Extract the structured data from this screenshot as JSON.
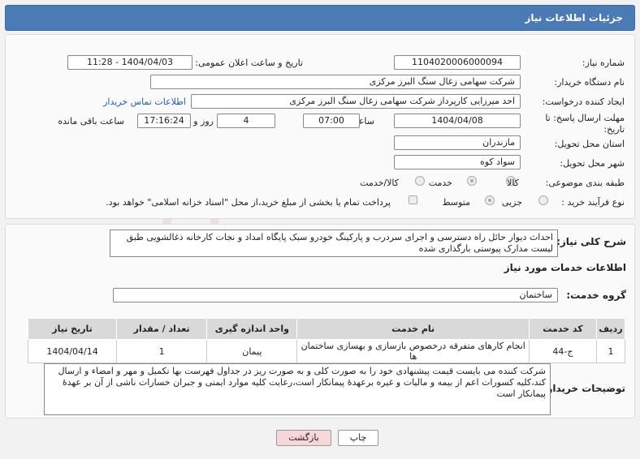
{
  "header": {
    "title": "جزئیات اطلاعات نیاز"
  },
  "fields": {
    "need_number_label": "شماره نیاز:",
    "need_number": "1104020006000094",
    "announce_label": "تاریخ و ساعت اعلان عمومی:",
    "announce_value": "1404/04/03 - 11:28",
    "buyer_org_label": "نام دستگاه خریدار:",
    "buyer_org": "شرکت سهامی زغال سنگ البرز مرکزی",
    "creator_label": "ایجاد کننده درخواست:",
    "creator": "احد میرزایی کارپرداز شرکت سهامی زغال سنگ البرز مرکزی",
    "contact_link": "اطلاعات تماس خریدار",
    "deadline_label": "مهلت ارسال پاسخ: تا تاریخ:",
    "deadline_date": "1404/04/08",
    "time_label": "ساعت",
    "deadline_time": "07:00",
    "days_value": "4",
    "days_label": "روز و",
    "remaining_time": "17:16:24",
    "remaining_label": "ساعت باقی مانده",
    "province_label": "استان محل تحویل:",
    "province": "مازندران",
    "city_label": "شهر محل تحویل:",
    "city": "سواد کوه",
    "category_label": "طبقه بندی موضوعی:",
    "category_options": [
      "کالا",
      "خدمت",
      "کالا/خدمت"
    ],
    "process_label": "نوع فرآیند خرید :",
    "process_options": [
      "جزیی",
      "متوسط"
    ],
    "payment_note": "پرداخت تمام یا بخشی از مبلغ خرید،از محل \"اسناد خزانه اسلامی\" خواهد بود."
  },
  "description": {
    "label": "شرح کلی نیاز:",
    "text": "احداث دیوار حائل راه دسترسی و اجرای سردرب و پارکینگ خودرو سبک پایگاه امداد و نجات کارخانه ذغالشویی طبق لیست مدارک پیوستی بارگذاری شده"
  },
  "services": {
    "section_title": "اطلاعات خدمات مورد نیاز",
    "group_label": "گروه خدمت:",
    "group_value": "ساختمان",
    "columns": [
      "ردیف",
      "کد خدمت",
      "نام خدمت",
      "واحد اندازه گیری",
      "تعداد / مقدار",
      "تاریخ نیاز"
    ],
    "rows": [
      [
        "1",
        "ج-44",
        "انجام کارهای متفرقه درخصوص بازسازی و بهسازی ساختمان ها",
        "پیمان",
        "1",
        "1404/04/14"
      ]
    ]
  },
  "buyer_notes": {
    "label": "توضیحات خریدار:",
    "text": "شرکت کننده می بایست قیمت پیشنهادی خود را به صورت کلی و به صورت ریز در جداول فهرست بها تکمیل و مهر و امضاء و ارسال کند،کلیه کسورات اعم از بیمه و مالیات و غیره برعهدهٔ پیمانکار است،رعایت کلیه موارد ایمنی و جبران خسارات ناشی از آن بر عهدهٔ پیمانکار است"
  },
  "buttons": {
    "print": "چاپ",
    "back": "بازگشت"
  },
  "colors": {
    "header_bg": "#4a7bb5",
    "link": "#1a5fb4",
    "back_btn": "#f7d7d7"
  }
}
